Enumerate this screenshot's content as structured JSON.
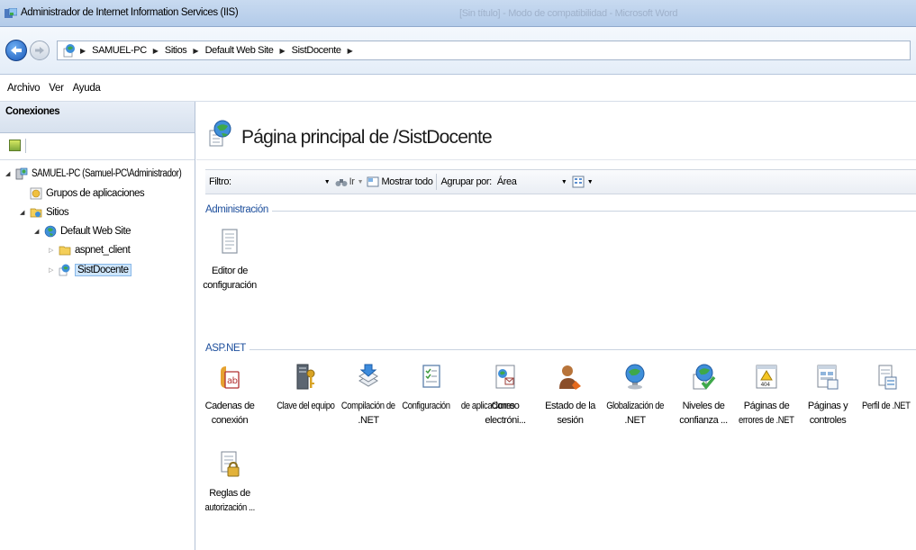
{
  "window": {
    "title": "Administrador de Internet Information Services (IIS)",
    "background_title": "[Sin título] - Modo de compatibilidad - Microsoft Word"
  },
  "address": {
    "crumbs": [
      "SAMUEL-PC",
      "Sitios",
      "Default Web Site",
      "SistDocente"
    ]
  },
  "menu": [
    "Archivo",
    "Ver",
    "Ayuda"
  ],
  "connections": {
    "header": "Conexiones",
    "tree": [
      {
        "label": "SAMUEL-PC (Samuel-PC\\Administrador)",
        "icon": "server-icon",
        "expanded": true
      },
      {
        "label": "Grupos de aplicaciones",
        "icon": "app-pools-icon"
      },
      {
        "label": "Sitios",
        "icon": "sites-folder-icon",
        "expanded": true
      },
      {
        "label": "Default Web Site",
        "icon": "website-globe-icon",
        "expanded": true
      },
      {
        "label": "aspnet_client",
        "icon": "folder-icon",
        "expanded": false
      },
      {
        "label": "SistDocente",
        "icon": "web-app-icon",
        "expanded": false,
        "selected": true
      }
    ]
  },
  "page": {
    "title": "Página principal de /SistDocente"
  },
  "filter": {
    "label": "Filtro:",
    "value": "",
    "go_label": "Ir",
    "show_all_label": "Mostrar todo",
    "group_by_label": "Agrupar por:",
    "group_by_value": "Área"
  },
  "groups": [
    {
      "name": "Administración",
      "features": [
        {
          "l1": "Editor de",
          "l2": "configuración",
          "icon": "config-editor-icon"
        }
      ]
    },
    {
      "name": "ASP.NET",
      "features": [
        {
          "l1": "Cadenas de",
          "l2": "conexión",
          "icon": "connection-strings-icon"
        },
        {
          "l1": "Clave del equipo",
          "l2": "",
          "icon": "machine-key-icon"
        },
        {
          "l1": "Compilación de",
          "l2": ".NET",
          "icon": "net-compilation-icon"
        },
        {
          "l1": "Configuración",
          "l2": "de aplicaciones",
          "icon": "app-settings-icon"
        },
        {
          "l1": "Correo",
          "l2": "electróni...",
          "icon": "smtp-email-icon"
        },
        {
          "l1": "Estado de la",
          "l2": "sesión",
          "icon": "session-state-icon"
        },
        {
          "l1": "Globalización de",
          "l2": ".NET",
          "icon": "net-globalization-icon"
        },
        {
          "l1": "Niveles de",
          "l2": "confianza ...",
          "icon": "trust-levels-icon"
        },
        {
          "l1": "Páginas de",
          "l2": "errores de .NET",
          "icon": "error-pages-icon"
        },
        {
          "l1": "Páginas y",
          "l2": "controles",
          "icon": "pages-controls-icon"
        },
        {
          "l1": "Perfil de .NET",
          "l2": "",
          "icon": "net-profile-icon"
        },
        {
          "l1": "Reglas de",
          "l2": "autorización ...",
          "icon": "authorization-rules-icon"
        }
      ]
    }
  ],
  "colors": {
    "group_header": "#1c4e9c",
    "selection": "#cde5fb",
    "titlebar": "#b3cbe9"
  }
}
